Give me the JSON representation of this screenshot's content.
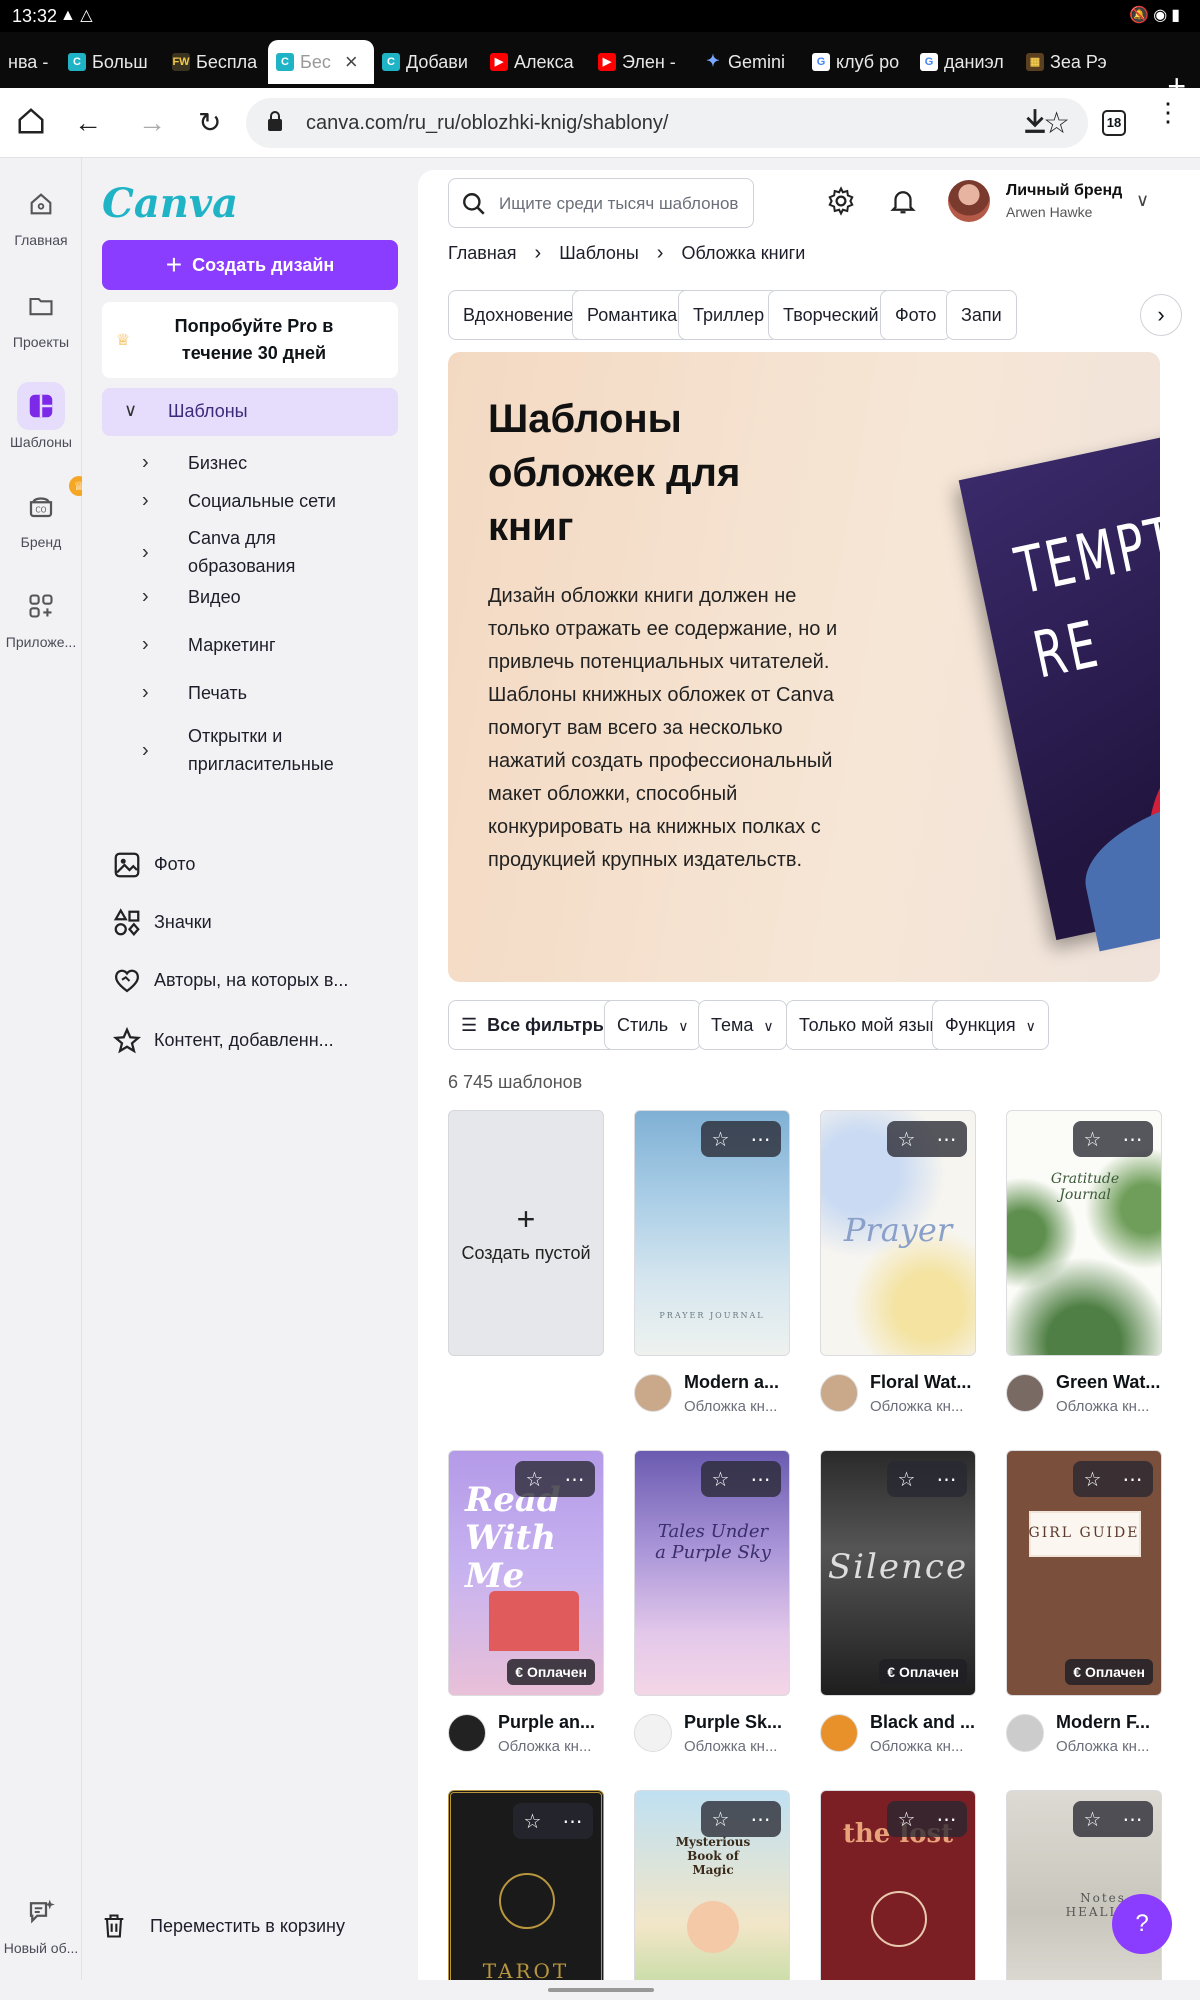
{
  "status": {
    "time": "13:32"
  },
  "tabs": [
    {
      "label": "нва -"
    },
    {
      "label": "Больш"
    },
    {
      "label": "Беспла"
    },
    {
      "label": "Бес"
    },
    {
      "label": "Добави"
    },
    {
      "label": "Алекса"
    },
    {
      "label": "Элен -"
    },
    {
      "label": "Gemini"
    },
    {
      "label": "клуб ро"
    },
    {
      "label": "даниэл"
    },
    {
      "label": "Зеа Рэ"
    }
  ],
  "url": "canva.com/ru_ru/oblozhki-knig/shablony/",
  "tab_count": "18",
  "rail": {
    "home": "Главная",
    "projects": "Проекты",
    "templates": "Шаблоны",
    "brand": "Бренд",
    "apps": "Приложе...",
    "new_chat": "Новый об..."
  },
  "sidebar": {
    "logo": "Canva",
    "create": "Создать дизайн",
    "pro": "Попробуйте Pro в течение 30 дней",
    "section": "Шаблоны",
    "subs": [
      "Бизнес",
      "Социальные сети",
      "Canva для образования",
      "Видео",
      "Маркетинг",
      "Печать",
      "Открытки и пригласительные"
    ],
    "photo": "Фото",
    "icons": "Значки",
    "authors": "Авторы, на которых в...",
    "content": "Контент, добавленн...",
    "trash": "Переместить в корзину"
  },
  "header": {
    "search_placeholder": "Ищите среди тысяч шаблонов",
    "brand_name": "Личный бренд",
    "brand_user": "Arwen Hawke"
  },
  "breadcrumbs": [
    "Главная",
    "Шаблоны",
    "Обложка книги"
  ],
  "chips": [
    "Вдохновение",
    "Романтика",
    "Триллер",
    "Творческий",
    "Фото",
    "Запи"
  ],
  "hero": {
    "title": "Шаблоны обложек для книг",
    "text": "Дизайн обложки книги должен не только отражать ее содержание, но и привлечь потенциальных читателей. Шаблоны книжных обложек от Canva помогут вам всего за несколько нажатий создать профессиональный макет обложки, способный конкурировать на книжных полках с продукцией крупных издательств.",
    "book_text": "TEMPT RE"
  },
  "filters": {
    "all": "Все фильтры",
    "style": "Стиль",
    "theme": "Тема",
    "lang": "Только мой язык",
    "func": "Функция"
  },
  "count": "6 745 шаблонов",
  "blank": {
    "label": "Создать пустой"
  },
  "paid_label": "€ Оплачен",
  "templates": [
    {
      "title": "Modern a...",
      "sub": "Обложка кн...",
      "cover_text": "PRAYER JOURNAL"
    },
    {
      "title": "Floral Wat...",
      "sub": "Обложка кн...",
      "cover_text": "Prayer"
    },
    {
      "title": "Green Wat...",
      "sub": "Обложка кн...",
      "cover_text": "Gratitude Journal"
    },
    {
      "title": "Purple an...",
      "sub": "Обложка кн...",
      "cover_text": "Read With Me"
    },
    {
      "title": "Purple Sk...",
      "sub": "Обложка кн...",
      "cover_text": "Tales Under a Purple Sky"
    },
    {
      "title": "Black and ...",
      "sub": "Обложка кн...",
      "cover_text": "Silence"
    },
    {
      "title": "Modern F...",
      "sub": "Обложка кн...",
      "cover_text": "GIRL GUIDE"
    },
    {
      "cover_text": "TAROT"
    },
    {
      "cover_text": "Mysterious Book of Magic"
    },
    {
      "cover_text": "the lost"
    },
    {
      "cover_text": "Notes HEALING"
    }
  ],
  "help": "?"
}
